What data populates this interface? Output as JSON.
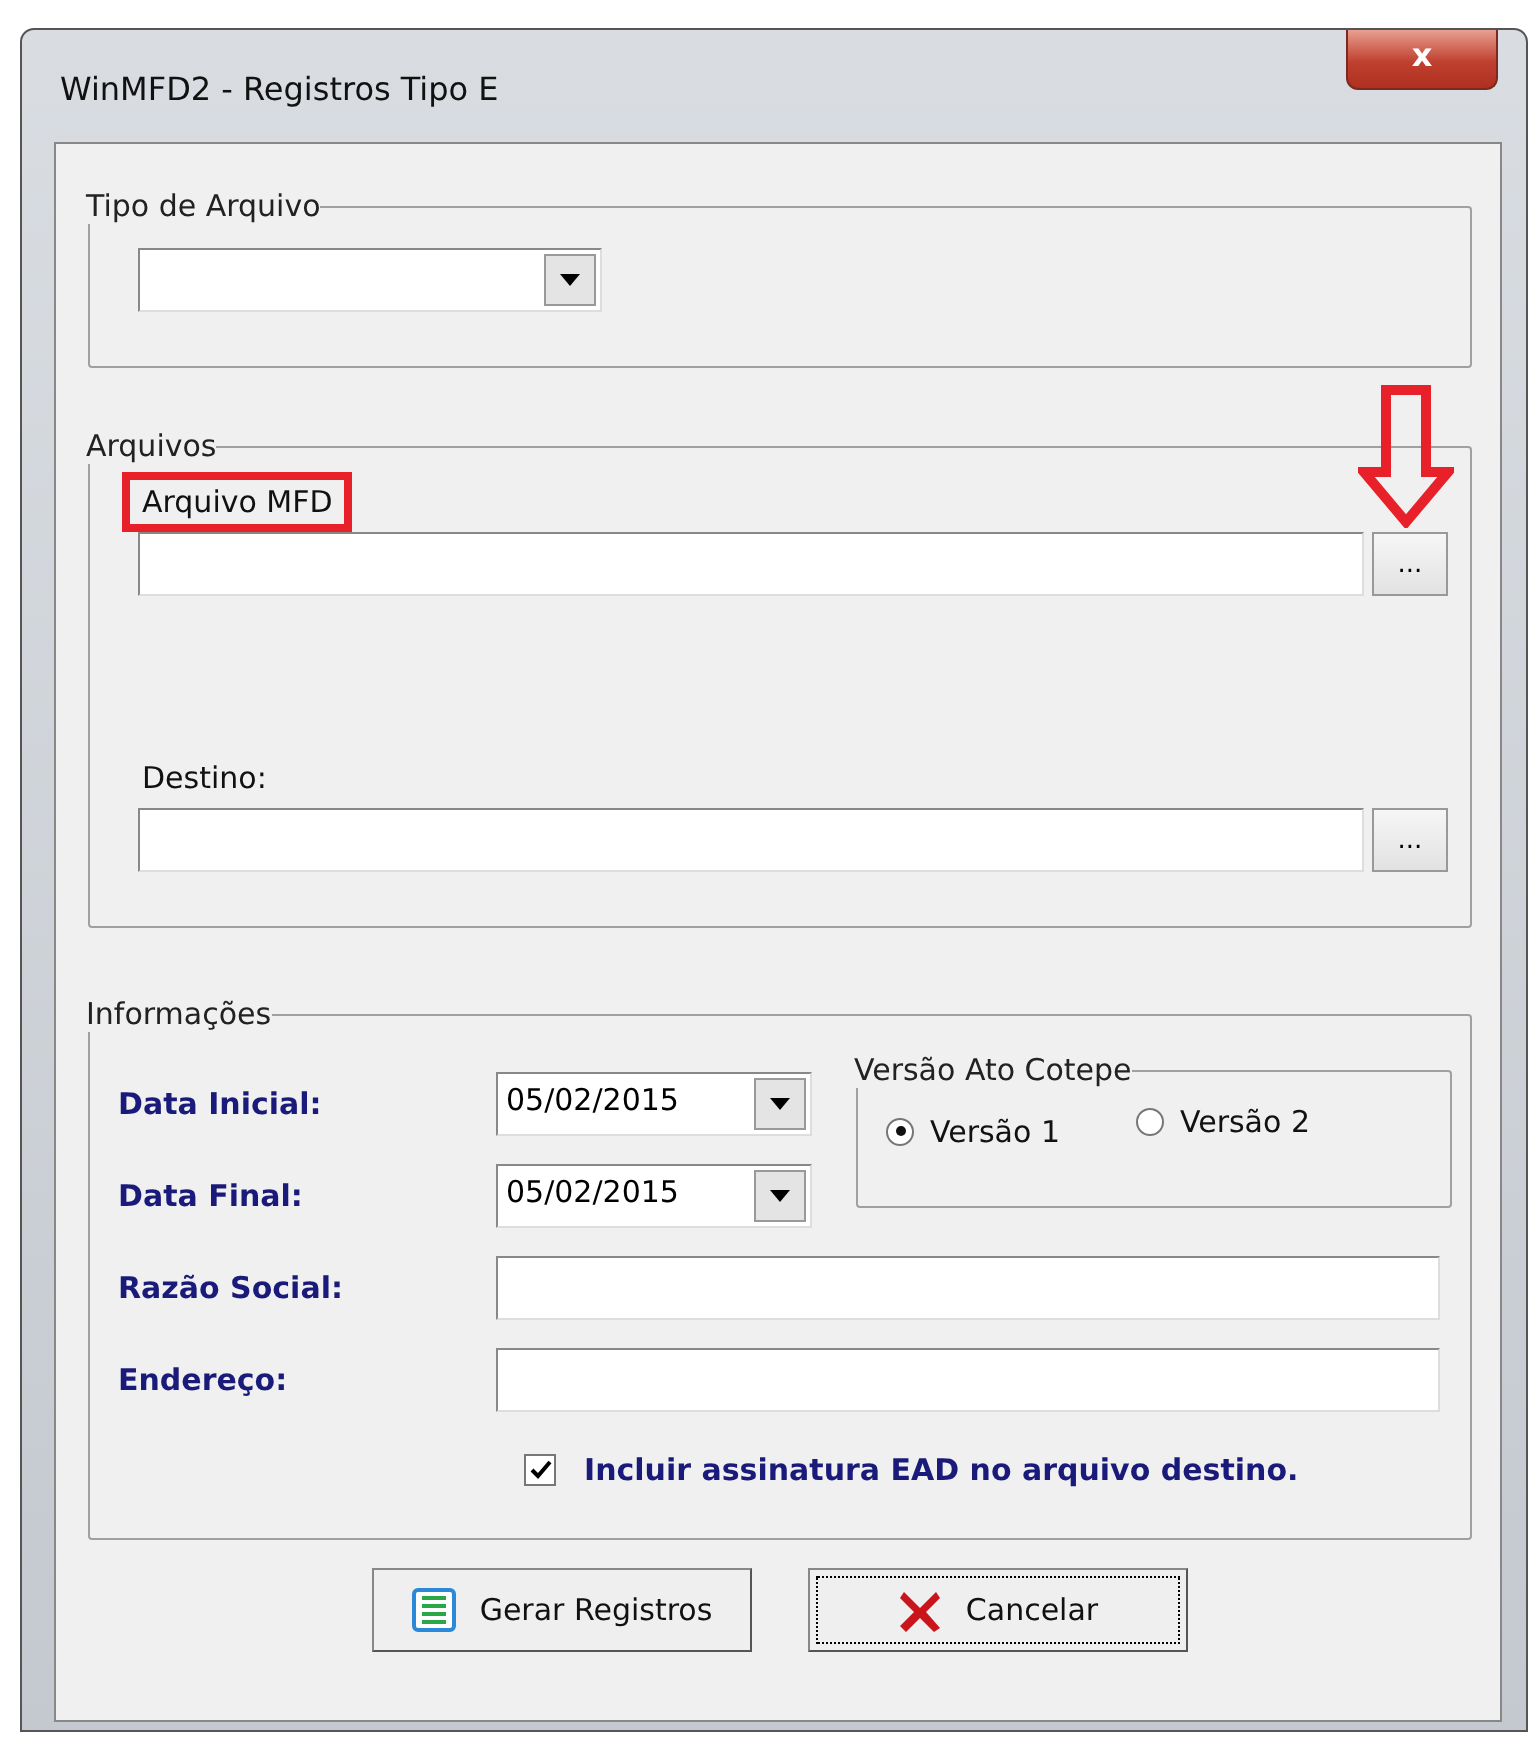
{
  "window": {
    "title": "WinMFD2 - Registros Tipo E",
    "close_label": "x"
  },
  "tipo_arquivo": {
    "legend": "Tipo de Arquivo"
  },
  "arquivos": {
    "legend": "Arquivos",
    "fields": [
      {
        "label": "Arquivo MFD",
        "highlighted": true,
        "arrow": true,
        "browse": "..."
      },
      {
        "label": "Destino:",
        "highlighted": false,
        "arrow": false,
        "browse": "..."
      }
    ]
  },
  "informacoes": {
    "legend": "Informações",
    "dates": [
      {
        "label": "Data Inicial:",
        "value": "05/02/2015"
      },
      {
        "label": "Data Final:",
        "value": "05/02/2015"
      }
    ],
    "versao": {
      "legend": "Versão Ato Cotepe",
      "options": [
        {
          "label": "Versão 1",
          "selected": true
        },
        {
          "label": "Versão 2",
          "selected": false
        }
      ]
    },
    "texts": [
      {
        "label": "Razão Social:"
      },
      {
        "label": "Endereço:"
      }
    ],
    "checkbox": {
      "label": "Incluir assinatura EAD no arquivo destino.",
      "checked": true
    }
  },
  "buttons": [
    {
      "label": "Gerar Registros",
      "kind": "list",
      "focused": false
    },
    {
      "label": "Cancelar",
      "kind": "cancel",
      "focused": true
    }
  ]
}
